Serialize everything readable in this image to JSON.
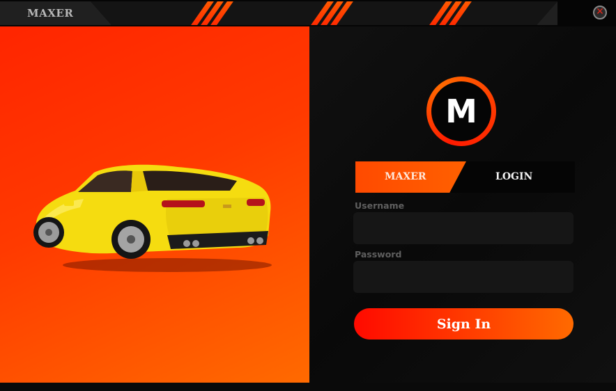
{
  "window": {
    "title": "MAXER",
    "close_icon": "close-icon"
  },
  "hero": {
    "image": "yellow-sports-car"
  },
  "login": {
    "logo_letter": "M",
    "tabs": [
      {
        "label": "MAXER",
        "active": true
      },
      {
        "label": "LOGIN",
        "active": false
      }
    ],
    "username": {
      "label": "Username",
      "value": "",
      "placeholder": ""
    },
    "password": {
      "label": "Password",
      "value": "",
      "placeholder": ""
    },
    "submit_label": "Sign In"
  },
  "colors": {
    "accent": "#ff4a00",
    "accent_red": "#ff1a00",
    "panel_dark": "#0b0b0b",
    "field_bg": "#161616",
    "muted_text": "#5f5f5f"
  }
}
